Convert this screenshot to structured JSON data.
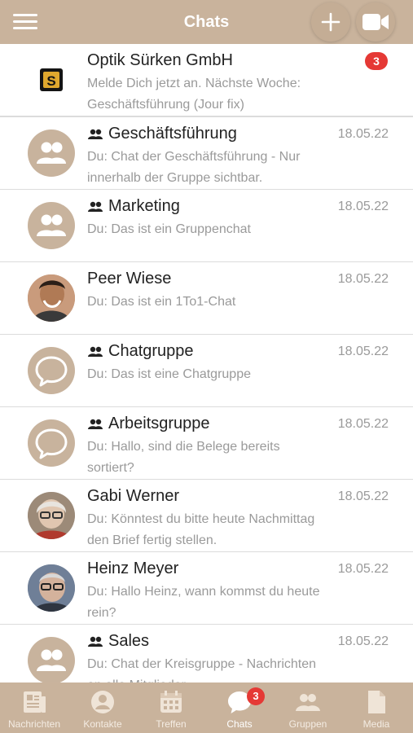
{
  "header": {
    "title": "Chats",
    "menu_icon": "hamburger-menu-icon",
    "add_icon": "plus-icon",
    "video_icon": "video-camera-icon"
  },
  "chats": [
    {
      "name": "Optik Sürken GmbH",
      "preview": "Melde Dich jetzt an. Nächste Woche: Geschäftsführung (Jour fix)",
      "date": "",
      "badge": "3",
      "group": false,
      "avatar": "company-logo"
    },
    {
      "name": "Geschäftsführung",
      "preview": "Du: Chat der Geschäftsführung - Nur innerhalb der Gruppe sichtbar.",
      "date": "18.05.22",
      "group": true,
      "avatar": "group-icon"
    },
    {
      "name": "Marketing",
      "preview": "Du: Das ist ein Gruppenchat",
      "date": "18.05.22",
      "group": true,
      "avatar": "group-icon"
    },
    {
      "name": "Peer Wiese",
      "preview": "Du: Das ist ein 1To1-Chat",
      "date": "18.05.22",
      "group": false,
      "avatar": "person-photo"
    },
    {
      "name": "Chatgruppe",
      "preview": "Du: Das ist eine Chatgruppe",
      "date": "18.05.22",
      "group": true,
      "avatar": "chat-bubble-icon"
    },
    {
      "name": "Arbeitsgruppe",
      "preview": "Du: Hallo, sind die Belege bereits sortiert?",
      "date": "18.05.22",
      "group": true,
      "avatar": "chat-bubble-icon"
    },
    {
      "name": "Gabi Werner",
      "preview": "Du: Könntest du bitte heute Nachmittag den Brief fertig stellen.",
      "date": "18.05.22",
      "group": false,
      "avatar": "person-photo"
    },
    {
      "name": "Heinz Meyer",
      "preview": "Du: Hallo Heinz, wann kommst du heute rein?",
      "date": "18.05.22",
      "group": false,
      "avatar": "person-photo"
    },
    {
      "name": "Sales",
      "preview": "Du: Chat der Kreisgruppe - Nachrichten an alle Mitglieder",
      "date": "18.05.22",
      "group": true,
      "avatar": "group-icon"
    }
  ],
  "tabs": [
    {
      "label": "Nachrichten",
      "icon": "newspaper-icon"
    },
    {
      "label": "Kontakte",
      "icon": "contact-icon"
    },
    {
      "label": "Treffen",
      "icon": "calendar-icon"
    },
    {
      "label": "Chats",
      "icon": "chat-icon",
      "badge": "3",
      "active": true
    },
    {
      "label": "Gruppen",
      "icon": "group-icon"
    },
    {
      "label": "Media",
      "icon": "document-icon"
    }
  ],
  "colors": {
    "brand": "#c9b39c",
    "badge": "#e53935"
  }
}
